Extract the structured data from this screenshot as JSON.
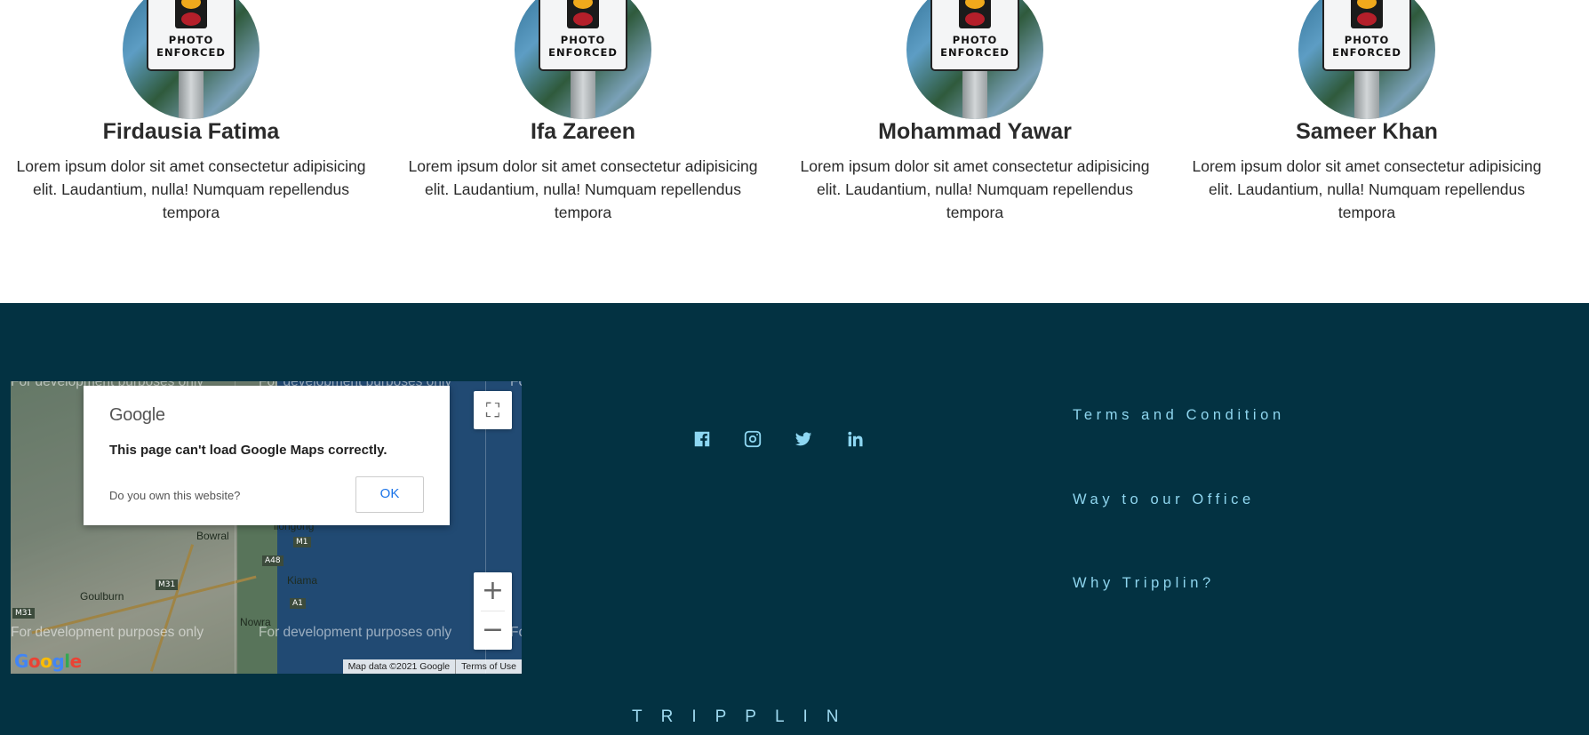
{
  "team": {
    "members": [
      {
        "name": "Firdausia Fatima",
        "description": "Lorem ipsum dolor sit amet consectetur adipisicing elit. Laudantium, nulla! Numquam repellendus tempora",
        "photo_text": "PHOTO ENFORCED"
      },
      {
        "name": "Ifa Zareen",
        "description": "Lorem ipsum dolor sit amet consectetur adipisicing elit. Laudantium, nulla! Numquam repellendus tempora",
        "photo_text": "PHOTO ENFORCED"
      },
      {
        "name": "Mohammad Yawar",
        "description": "Lorem ipsum dolor sit amet consectetur adipisicing elit. Laudantium, nulla! Numquam repellendus tempora",
        "photo_text": "PHOTO ENFORCED"
      },
      {
        "name": "Sameer Khan",
        "description": "Lorem ipsum dolor sit amet consectetur adipisicing elit. Laudantium, nulla! Numquam repellendus tempora",
        "photo_text": "PHOTO ENFORCED"
      }
    ]
  },
  "footer": {
    "background_color": "#033242",
    "map": {
      "dialog_brand": "Google",
      "dialog_message": "This page can't load Google Maps correctly.",
      "dialog_question": "Do you own this website?",
      "dialog_ok": "OK",
      "watermark": "For development purposes only",
      "watermark_cut": "Fo",
      "places": [
        "Bowral",
        "Goulburn",
        "Kiama",
        "Nowra",
        "llongong"
      ],
      "road_shields": [
        "M31",
        "M31",
        "A48",
        "M1",
        "A1"
      ],
      "zoom_in": "+",
      "zoom_out": "−",
      "fullscreen_icon": "fullscreen-icon",
      "logo": "Google",
      "attribution_data": "Map data ©2021 Google",
      "attribution_terms": "Terms of Use"
    },
    "social": [
      {
        "icon": "facebook-icon"
      },
      {
        "icon": "instagram-icon"
      },
      {
        "icon": "twitter-icon"
      },
      {
        "icon": "linkedin-icon"
      }
    ],
    "links": [
      "Terms and Condition",
      "Way to our Office",
      "Why Tripplin?"
    ],
    "brand": "TRIPPLIN",
    "accent_color": "#8fd6ef"
  }
}
